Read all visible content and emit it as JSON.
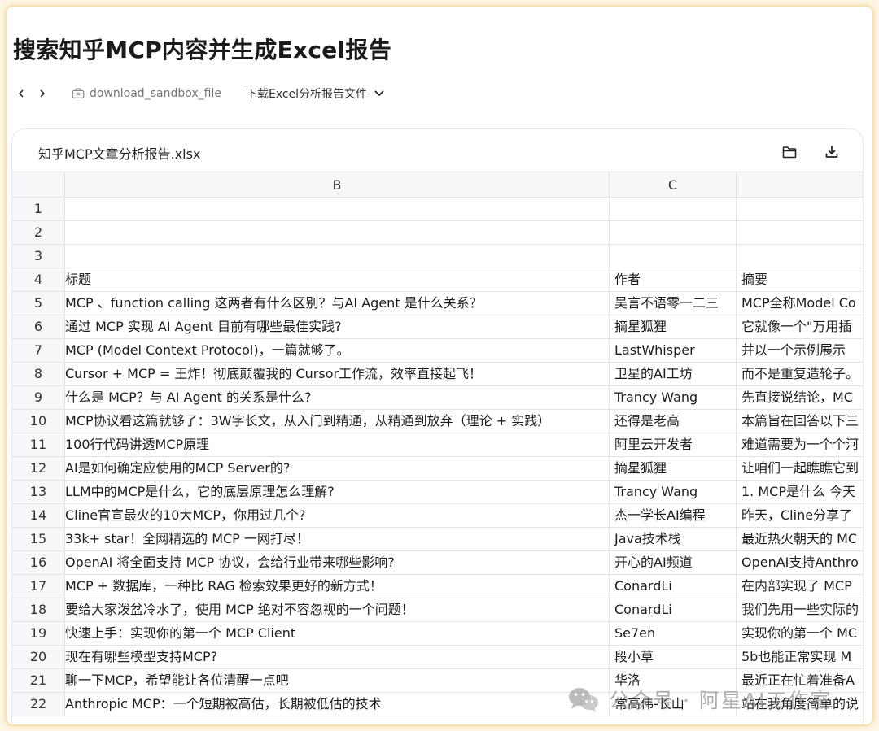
{
  "page": {
    "title": "搜索知乎MCP内容并生成Excel报告"
  },
  "toolbar": {
    "tool_name": "download_sandbox_file",
    "action_label": "下载Excel分析报告文件"
  },
  "file": {
    "name": "知乎MCP文章分析报告.xlsx",
    "open_folder_icon": "folder-icon",
    "download_icon": "download-icon"
  },
  "sheet": {
    "columns": [
      "B",
      "C",
      ""
    ],
    "rows": [
      {
        "num": "1",
        "b": "",
        "c": "",
        "d": ""
      },
      {
        "num": "2",
        "b": "",
        "c": "",
        "d": ""
      },
      {
        "num": "3",
        "b": "",
        "c": "",
        "d": ""
      },
      {
        "num": "4",
        "b": "标题",
        "c": "作者",
        "d": "摘要"
      },
      {
        "num": "5",
        "b": "MCP 、function calling 这两者有什么区别？与AI Agent 是什么关系？",
        "c": "吴言不语零一二三",
        "d": "MCP全称Model Co"
      },
      {
        "num": "6",
        "b": "通过 MCP 实现 AI Agent 目前有哪些最佳实践?",
        "c": "摘星狐狸",
        "d": "它就像一个\"万用插"
      },
      {
        "num": "7",
        "b": "MCP (Model Context Protocol)，一篇就够了。",
        "c": "LastWhisper",
        "d": "并以一个示例展示"
      },
      {
        "num": "8",
        "b": "Cursor + MCP = 王炸！彻底颠覆我的 Cursor工作流，效率直接起飞！",
        "c": "卫星的AI工坊",
        "d": "而不是重复造轮子。"
      },
      {
        "num": "9",
        "b": "什么是 MCP？与 AI Agent 的关系是什么?",
        "c": "Trancy Wang",
        "d": "先直接说结论，MC"
      },
      {
        "num": "10",
        "b": "MCP协议看这篇就够了：3W字长文，从入门到精通，从精通到放弃（理论 + 实践）",
        "c": "还得是老高",
        "d": "本篇旨在回答以下三"
      },
      {
        "num": "11",
        "b": "100行代码讲透MCP原理",
        "c": "阿里云开发者",
        "d": "难道需要为一个个河"
      },
      {
        "num": "12",
        "b": "AI是如何确定应使用的MCP Server的?",
        "c": "摘星狐狸",
        "d": "让咱们一起瞧瞧它到"
      },
      {
        "num": "13",
        "b": "LLM中的MCP是什么，它的底层原理怎么理解?",
        "c": "Trancy Wang",
        "d": "1. MCP是什么 今天"
      },
      {
        "num": "14",
        "b": "Cline官宣最火的10大MCP，你用过几个?",
        "c": "杰一学长AI编程",
        "d": "昨天，Cline分享了"
      },
      {
        "num": "15",
        "b": "33k+ star！全网精选的 MCP 一网打尽！",
        "c": "Java技术栈",
        "d": "最近热火朝天的 MC"
      },
      {
        "num": "16",
        "b": "OpenAI 将全面支持 MCP 协议，会给行业带来哪些影响?",
        "c": "开心的AI频道",
        "d": "OpenAI支持Anthro"
      },
      {
        "num": "17",
        "b": "MCP + 数据库，一种比 RAG 检索效果更好的新方式！",
        "c": "ConardLi",
        "d": "在内部实现了 MCP"
      },
      {
        "num": "18",
        "b": "要给大家泼盆冷水了，使用 MCP 绝对不容忽视的一个问题！",
        "c": "ConardLi",
        "d": "我们先用一些实际的"
      },
      {
        "num": "19",
        "b": "快速上手：实现你的第一个 MCP Client",
        "c": "Se7en",
        "d": "实现你的第一个 MC"
      },
      {
        "num": "20",
        "b": "现在有哪些模型支持MCP?",
        "c": "段小草",
        "d": "5b也能正常实现 M"
      },
      {
        "num": "21",
        "b": "聊一下MCP，希望能让各位清醒一点吧",
        "c": "华洛",
        "d": "最近正在忙着准备A"
      },
      {
        "num": "22",
        "b": "Anthropic MCP：一个短期被高估，长期被低估的技术",
        "c": "常高伟-长山",
        "d": "站在我角度简单的说"
      }
    ]
  },
  "watermark": {
    "text": "公众号 · 阿星AI工作室"
  }
}
